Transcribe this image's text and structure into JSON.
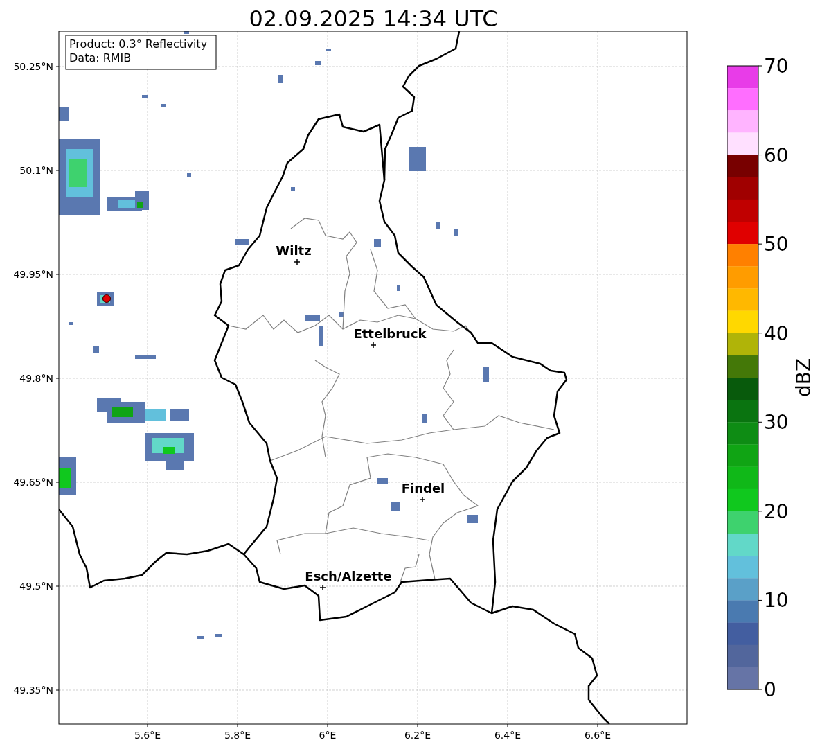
{
  "title": "02.09.2025 14:34 UTC",
  "info_box": {
    "lines": [
      "Product: 0.3° Reflectivity",
      "Data: RMIB"
    ]
  },
  "axes": {
    "xticks": [
      "5.6°E",
      "5.8°E",
      "6°E",
      "6.2°E",
      "6.4°E",
      "6.6°E"
    ],
    "yticks": [
      "50.25°N",
      "50.1°N",
      "49.95°N",
      "49.8°N",
      "49.65°N",
      "49.5°N",
      "49.35°N"
    ]
  },
  "cities": [
    {
      "name": "Wiltz"
    },
    {
      "name": "Ettelbruck"
    },
    {
      "name": "Findel"
    },
    {
      "name": "Esch/Alzette"
    }
  ],
  "colorbar": {
    "label": "dBZ",
    "ticks": [
      "70",
      "60",
      "50",
      "40",
      "30",
      "20",
      "10",
      "0"
    ],
    "segments": [
      {
        "color": "#e83ce8"
      },
      {
        "color": "#ff6eff"
      },
      {
        "color": "#ffb4ff"
      },
      {
        "color": "#ffe0ff"
      },
      {
        "color": "#780000"
      },
      {
        "color": "#a00000"
      },
      {
        "color": "#c00000"
      },
      {
        "color": "#e00000"
      },
      {
        "color": "#ff8000"
      },
      {
        "color": "#ff9c00"
      },
      {
        "color": "#ffb800"
      },
      {
        "color": "#ffd800"
      },
      {
        "color": "#b0b408"
      },
      {
        "color": "#447808"
      },
      {
        "color": "#085a0c"
      },
      {
        "color": "#0a7410"
      },
      {
        "color": "#0e8c14"
      },
      {
        "color": "#10a414"
      },
      {
        "color": "#10b818"
      },
      {
        "color": "#10c81e"
      },
      {
        "color": "#3ed26e"
      },
      {
        "color": "#62d8c8"
      },
      {
        "color": "#62c0dc"
      },
      {
        "color": "#5aa0c8"
      },
      {
        "color": "#4a7ab0"
      },
      {
        "color": "#435ea0"
      },
      {
        "color": "#52669c"
      },
      {
        "color": "#6674a6"
      }
    ]
  }
}
